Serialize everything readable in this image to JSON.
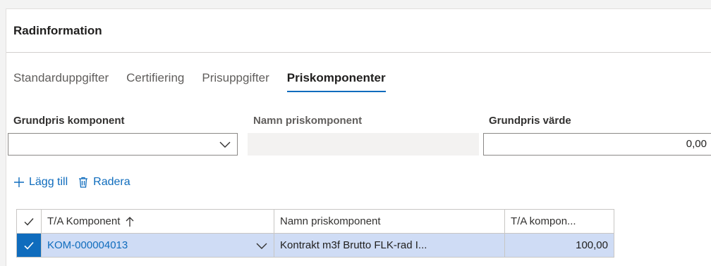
{
  "section": {
    "title": "Radinformation"
  },
  "tabs": [
    {
      "label": "Standarduppgifter",
      "active": false
    },
    {
      "label": "Certifiering",
      "active": false
    },
    {
      "label": "Prisuppgifter",
      "active": false
    },
    {
      "label": "Priskomponenter",
      "active": true
    }
  ],
  "fields": {
    "base_component": {
      "label": "Grundpris komponent",
      "value": ""
    },
    "component_name": {
      "label": "Namn priskomponent",
      "value": ""
    },
    "base_value": {
      "label": "Grundpris värde",
      "value": "0,00"
    }
  },
  "toolbar": {
    "add_label": "Lägg till",
    "delete_label": "Radera"
  },
  "grid": {
    "columns": [
      "T/A Komponent",
      "Namn priskomponent",
      "T/A kompon..."
    ],
    "rows": [
      {
        "component": "KOM-000004013",
        "name": "Kontrakt m3f Brutto FLK-rad I...",
        "value": "100,00",
        "selected": true
      }
    ]
  },
  "colors": {
    "accent": "#0f6cbd",
    "selected_row": "#cfdcf5"
  }
}
